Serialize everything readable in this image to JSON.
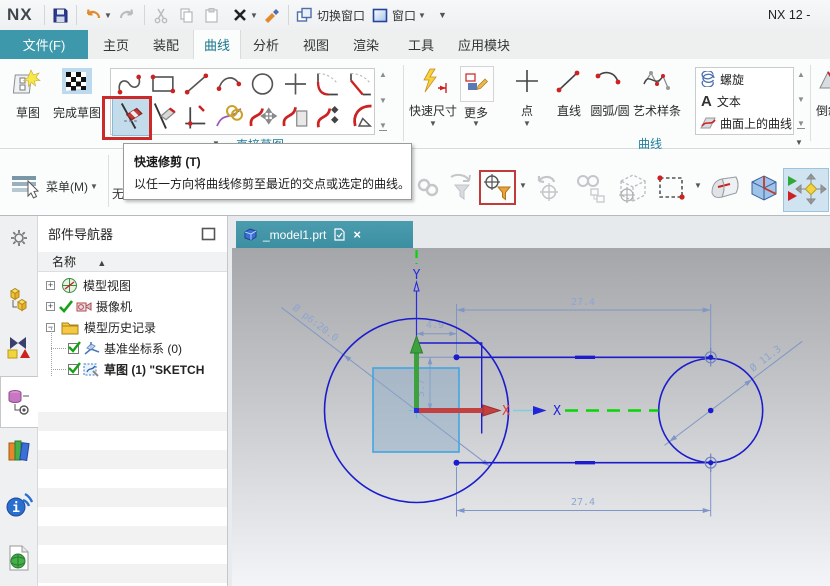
{
  "titlebar": {
    "logo": "NX",
    "switch_window": "切换窗口",
    "window": "窗口",
    "right_title": "NX 12 -"
  },
  "tabs": {
    "file": "文件(F)",
    "home": "主页",
    "assembly": "装配",
    "curve": "曲线",
    "analysis": "分析",
    "view": "视图",
    "render": "渲染",
    "tools": "工具",
    "application": "应用模块"
  },
  "ribbon": {
    "sketch": "草图",
    "finish_sketch": "完成草图",
    "quick_dim": "快速尺寸",
    "more": "更多",
    "point": "点",
    "line": "直线",
    "arc_circle": "圆弧/圆",
    "art_spline": "艺术样条",
    "list_helix": "螺旋",
    "list_text": "文本",
    "list_curve_on_surface": "曲面上的曲线",
    "group_curve": "曲线",
    "group_direct_sketch": "直接草图",
    "partial_right": "倒斜角"
  },
  "tooltip": {
    "title": "快速修剪 (T)",
    "desc": "以任一方向将曲线修剪至最近的交点或选定的曲线。"
  },
  "menubar": {
    "menu": "菜单(M)",
    "filter_value": "无"
  },
  "navigator": {
    "title": "部件导航器",
    "header": "名称",
    "item_model_views": "模型视图",
    "item_cameras": "摄像机",
    "item_history": "模型历史记录",
    "item_csys": "基准坐标系 (0)",
    "item_sketch": "草图 (1) \"SKETCH"
  },
  "viewport": {
    "tab": "_model1.prt"
  },
  "sketch": {
    "dim_top": "27.4",
    "dim_bottom": "27.4",
    "dim_width": "4.9",
    "dim_height": "5.7",
    "dim_big_circle": "Ø p6:20.0",
    "dim_small_circle": "Ø 11.3",
    "axis_x_red": "X",
    "axis_x_blue": "X",
    "axis_y": "Y"
  }
}
